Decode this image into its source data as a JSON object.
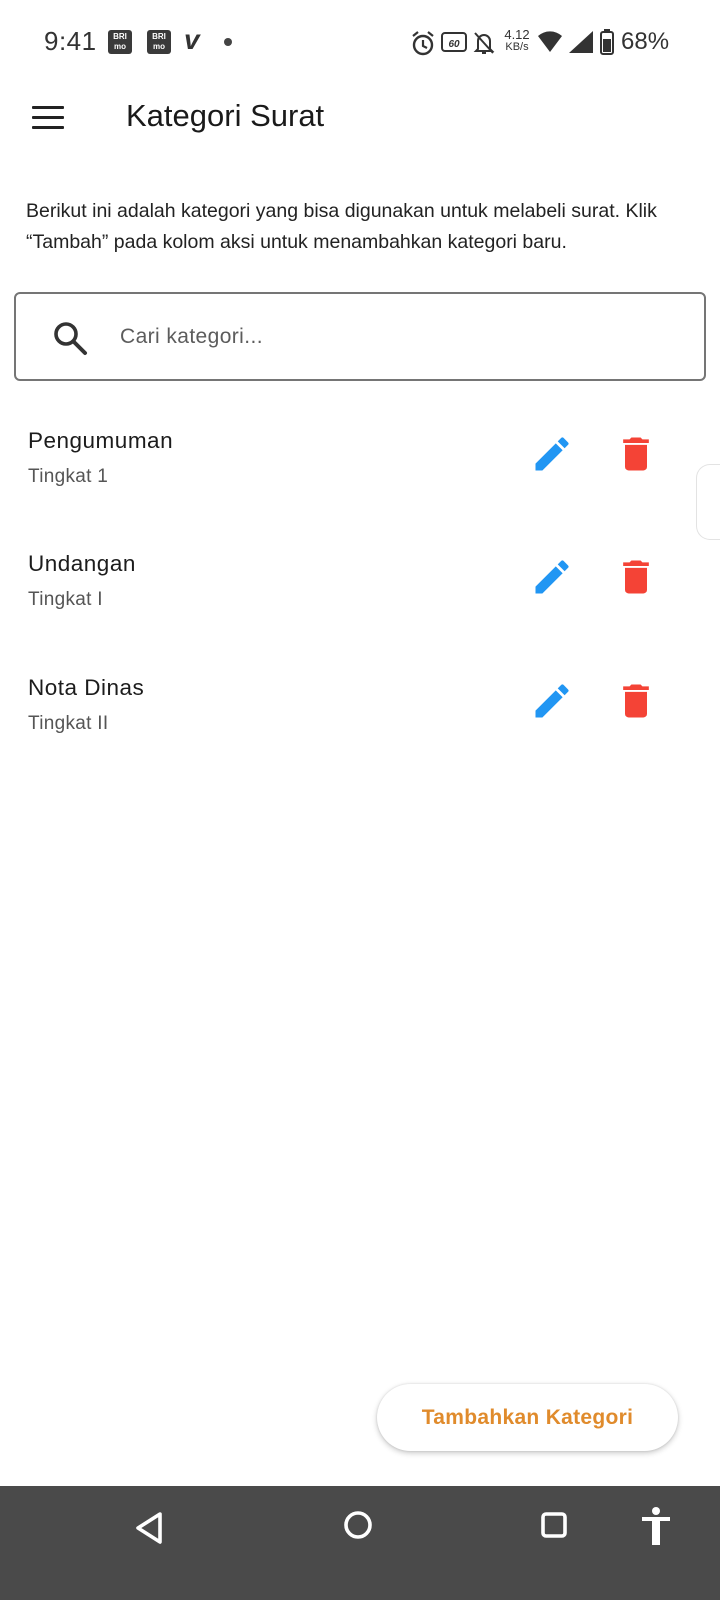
{
  "status_bar": {
    "time": "9:41",
    "notification_icons": [
      "bri-mo-icon",
      "bri-mo-icon",
      "vidio-icon",
      "dot-icon"
    ],
    "bri_label": "BRI mo",
    "network_speed_value": "4.12",
    "network_speed_unit": "KB/s",
    "refresh_rate": "60",
    "battery": "68%"
  },
  "app_bar": {
    "title": "Kategori Surat"
  },
  "description": "Berikut ini adalah kategori yang bisa digunakan untuk melabeli surat. Klik “Tambah” pada kolom aksi untuk menambahkan kategori baru.",
  "search": {
    "value": "",
    "placeholder": "Cari kategori..."
  },
  "categories": [
    {
      "name": "Pengumuman",
      "level": "Tingkat 1"
    },
    {
      "name": "Undangan",
      "level": "Tingkat I"
    },
    {
      "name": "Nota Dinas",
      "level": "Tingkat II"
    }
  ],
  "fab": {
    "label": "Tambahkan Kategori"
  },
  "colors": {
    "edit": "#2196f3",
    "delete": "#f44336",
    "fab_text": "#e08b2c",
    "nav_bar": "#4a4a4a"
  }
}
